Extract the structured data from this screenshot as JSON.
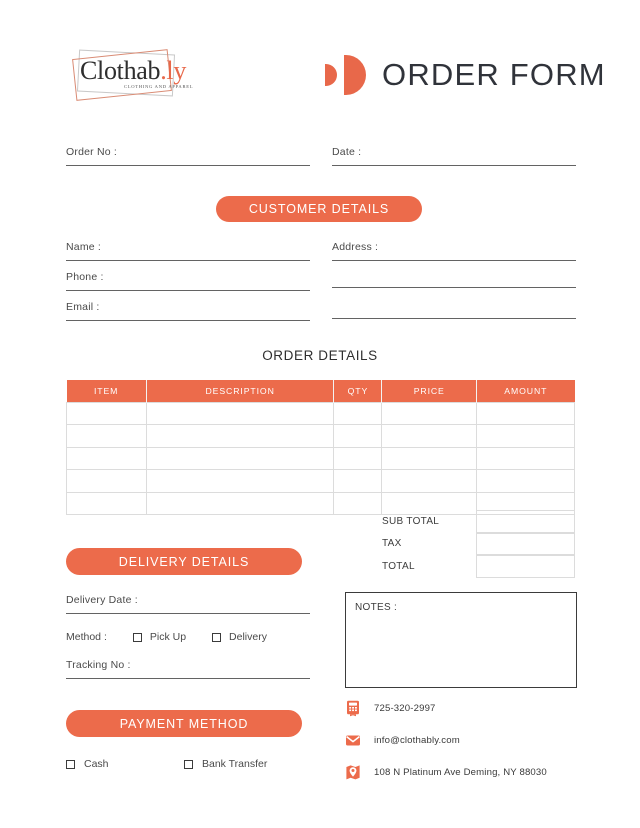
{
  "header": {
    "logo": {
      "name_main": "Clothab",
      "name_accent": ".ly",
      "tagline": "CLOTHING AND APPAREL"
    },
    "title": "ORDER FORM"
  },
  "top_fields": [
    {
      "label": "Order No :"
    },
    {
      "label": "Date :"
    }
  ],
  "customer": {
    "banner": "CUSTOMER DETAILS",
    "left_fields": [
      {
        "label": "Name :"
      },
      {
        "label": "Phone :"
      },
      {
        "label": "Email :"
      }
    ],
    "right_fields": [
      {
        "label": "Address :"
      }
    ]
  },
  "order_details": {
    "section_title": "ORDER DETAILS",
    "columns": [
      "ITEM",
      "DESCRIPTION",
      "QTY",
      "PRICE",
      "AMOUNT"
    ],
    "rows": [
      [
        "",
        "",
        "",
        "",
        ""
      ],
      [
        "",
        "",
        "",
        "",
        ""
      ],
      [
        "",
        "",
        "",
        "",
        ""
      ],
      [
        "",
        "",
        "",
        "",
        ""
      ],
      [
        "",
        "",
        "",
        "",
        ""
      ]
    ],
    "totals": [
      {
        "label": "SUB TOTAL",
        "value": ""
      },
      {
        "label": "TAX",
        "value": ""
      },
      {
        "label": "TOTAL",
        "value": ""
      }
    ]
  },
  "delivery": {
    "banner": "DELIVERY DETAILS",
    "date_label": "Delivery Date :",
    "method_label": "Method :",
    "options": [
      {
        "label": "Pick Up",
        "checked": false
      },
      {
        "label": "Delivery",
        "checked": false
      }
    ],
    "tracking_label": "Tracking No :"
  },
  "notes": {
    "label": "NOTES :",
    "value": ""
  },
  "payment": {
    "banner": "PAYMENT METHOD",
    "options": [
      {
        "label": "Cash",
        "checked": false
      },
      {
        "label": "Bank Transfer",
        "checked": false
      }
    ]
  },
  "contact": [
    {
      "icon": "phone-icon",
      "text": "725-320-2997"
    },
    {
      "icon": "envelope-icon",
      "text": "info@clothably.com"
    },
    {
      "icon": "map-pin-icon",
      "text": "108 N Platinum Ave Deming, NY 88030"
    }
  ],
  "colors": {
    "accent": "#ec6b4b",
    "accent_dark": "#e8684a",
    "text": "#3a3a3a",
    "rule": "#636363",
    "table_border": "#dcdcdc"
  }
}
